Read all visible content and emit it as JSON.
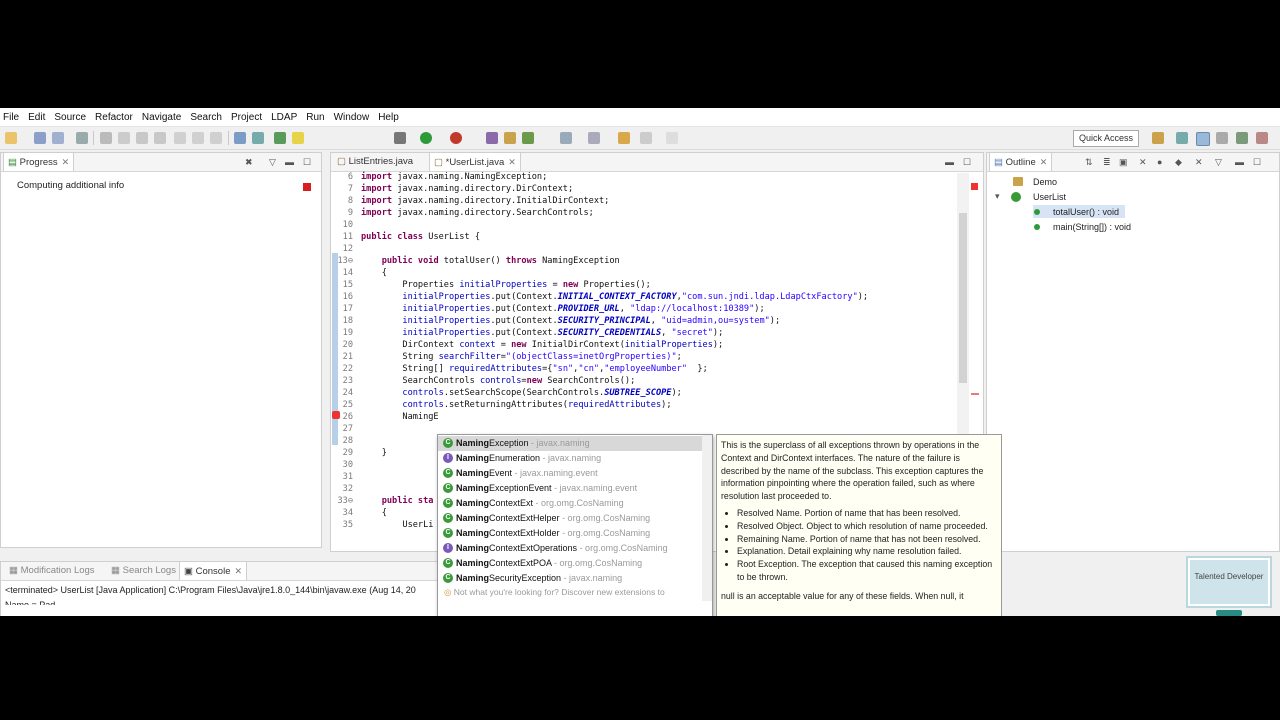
{
  "menu": [
    "File",
    "Edit",
    "Source",
    "Refactor",
    "Navigate",
    "Search",
    "Project",
    "LDAP",
    "Run",
    "Window",
    "Help"
  ],
  "toolbar": {
    "quick_access": "Quick Access"
  },
  "progress": {
    "tab": "Progress",
    "status": "Computing additional info"
  },
  "editor": {
    "tabs": [
      "ListEntries.java",
      "*UserList.java"
    ],
    "lines": [
      {
        "n": "6",
        "html": "<span class='kw'>import</span> javax.naming.NamingException;"
      },
      {
        "n": "7",
        "html": "<span class='kw'>import</span> javax.naming.directory.DirContext;"
      },
      {
        "n": "8",
        "html": "<span class='kw'>import</span> javax.naming.directory.InitialDirContext;"
      },
      {
        "n": "9",
        "html": "<span class='kw'>import</span> javax.naming.directory.SearchControls;"
      },
      {
        "n": "10",
        "html": ""
      },
      {
        "n": "11",
        "html": "<span class='kw'>public class</span> UserList {"
      },
      {
        "n": "12",
        "html": ""
      },
      {
        "n": "13⊖",
        "html": "    <span class='kw'>public void</span> totalUser() <span class='kw'>throws</span> NamingException"
      },
      {
        "n": "14",
        "html": "    {"
      },
      {
        "n": "15",
        "html": "        Properties <span class='fld'>initialProperties</span> = <span class='kw'>new</span> Properties();"
      },
      {
        "n": "16",
        "html": "        <span class='fld'>initialProperties</span>.put(Context.<span class='cst'>INITIAL_CONTEXT_FACTORY</span>,<span class='str'>\"com.sun.jndi.ldap.LdapCtxFactory\"</span>);"
      },
      {
        "n": "17",
        "html": "        <span class='fld'>initialProperties</span>.put(Context.<span class='cst'>PROVIDER_URL</span>, <span class='str'>\"ldap://localhost:10389\"</span>);"
      },
      {
        "n": "18",
        "html": "        <span class='fld'>initialProperties</span>.put(Context.<span class='cst'>SECURITY_PRINCIPAL</span>, <span class='str'>\"uid=admin,ou=system\"</span>);"
      },
      {
        "n": "19",
        "html": "        <span class='fld'>initialProperties</span>.put(Context.<span class='cst'>SECURITY_CREDENTIALS</span>, <span class='str'>\"secret\"</span>);"
      },
      {
        "n": "20",
        "html": "        DirContext <span class='fld'>context</span> = <span class='kw'>new</span> InitialDirContext(<span class='fld'>initialProperties</span>);"
      },
      {
        "n": "21",
        "html": "        String <span class='fld'>searchFilter</span>=<span class='str'>\"(objectClass=inetOrgProperties)\"</span>;"
      },
      {
        "n": "22",
        "html": "        String[] <span class='fld'>requiredAttributes</span>={<span class='str'>\"sn\"</span>,<span class='str'>\"cn\"</span>,<span class='str'>\"employeeNumber\"</span>  };"
      },
      {
        "n": "23",
        "html": "        SearchControls <span class='fld'>controls</span>=<span class='kw'>new</span> SearchControls();"
      },
      {
        "n": "24",
        "html": "        <span class='fld'>controls</span>.setSearchScope(SearchControls.<span class='cst'>SUBTREE_SCOPE</span>);"
      },
      {
        "n": "25",
        "html": "        <span class='fld'>controls</span>.setReturningAttributes(<span class='fld'>requiredAttributes</span>);"
      },
      {
        "n": "26",
        "html": "        NamingE"
      },
      {
        "n": "27",
        "html": ""
      },
      {
        "n": "28",
        "html": ""
      },
      {
        "n": "29",
        "html": "    }"
      },
      {
        "n": "30",
        "html": ""
      },
      {
        "n": "31",
        "html": ""
      },
      {
        "n": "32",
        "html": ""
      },
      {
        "n": "33⊖",
        "html": "    <span class='kw'>public sta</span>"
      },
      {
        "n": "34",
        "html": "    {"
      },
      {
        "n": "35",
        "html": "        UserLi"
      }
    ]
  },
  "completion": {
    "items": [
      {
        "icon": "C",
        "bold": "Naming",
        "rest": "Exception",
        "pkg": " - javax.naming"
      },
      {
        "icon": "I",
        "bold": "Naming",
        "rest": "Enumeration",
        "pkg": " - javax.naming"
      },
      {
        "icon": "C",
        "bold": "Naming",
        "rest": "Event",
        "pkg": " - javax.naming.event"
      },
      {
        "icon": "C",
        "bold": "Naming",
        "rest": "ExceptionEvent",
        "pkg": " - javax.naming.event"
      },
      {
        "icon": "C",
        "bold": "Naming",
        "rest": "ContextExt",
        "pkg": " - org.omg.CosNaming"
      },
      {
        "icon": "C",
        "bold": "Naming",
        "rest": "ContextExtHelper",
        "pkg": " - org.omg.CosNaming"
      },
      {
        "icon": "C",
        "bold": "Naming",
        "rest": "ContextExtHolder",
        "pkg": " - org.omg.CosNaming"
      },
      {
        "icon": "I",
        "bold": "Naming",
        "rest": "ContextExtOperations",
        "pkg": " - org.omg.CosNaming"
      },
      {
        "icon": "C",
        "bold": "Naming",
        "rest": "ContextExtPOA",
        "pkg": " - org.omg.CosNaming"
      },
      {
        "icon": "C",
        "bold": "Naming",
        "rest": "SecurityException",
        "pkg": " - javax.naming"
      }
    ],
    "more": "Not what you're looking for? Discover new extensions to"
  },
  "javadoc": {
    "intro": "This is the superclass of all exceptions thrown by operations in the Context and DirContext interfaces. The nature of the failure is described by the name of the subclass. This exception captures the information pinpointing where the operation failed, such as where resolution last proceeded to.",
    "bullets": [
      "Resolved Name. Portion of name that has been resolved.",
      "Resolved Object. Object to which resolution of name proceeded.",
      "Remaining Name. Portion of name that has not been resolved.",
      "Explanation. Detail explaining why name resolution failed.",
      "Root Exception. The exception that caused this naming exception to be thrown."
    ],
    "tail": "null is an acceptable value for any of these fields. When null, it"
  },
  "outline": {
    "tab": "Outline",
    "items": [
      "Demo",
      "UserList",
      "totalUser() : void",
      "main(String[]) : void"
    ]
  },
  "console": {
    "tabs": [
      "Modification Logs",
      "Search Logs",
      "Console"
    ],
    "line1": "<terminated> UserList [Java Application] C:\\Program Files\\Java\\jre1.8.0_144\\bin\\javaw.exe (Aug 14, 20",
    "line2": "Name = Pad"
  },
  "logo": {
    "text": "Talented Developer"
  }
}
